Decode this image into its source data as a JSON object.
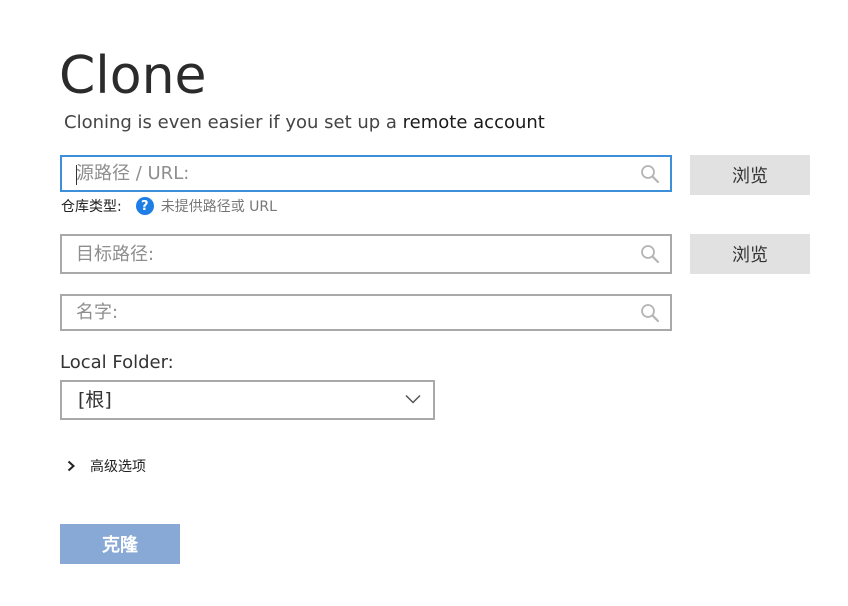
{
  "header": {
    "title": "Clone",
    "subtitle_text": "Cloning is even easier if you set up a ",
    "subtitle_link": "remote account"
  },
  "source": {
    "placeholder": "源路径 / URL:",
    "value": "",
    "browse_label": "浏览",
    "search_icon": "search-icon"
  },
  "repo_type": {
    "label": "仓库类型:",
    "help_glyph": "?",
    "status": "未提供路径或 URL"
  },
  "target": {
    "placeholder": "目标路径:",
    "value": "",
    "browse_label": "浏览"
  },
  "name": {
    "placeholder": "名字:",
    "value": ""
  },
  "local_folder": {
    "label": "Local Folder:",
    "selected": "[根]"
  },
  "advanced": {
    "label": "高级选项"
  },
  "actions": {
    "clone_label": "克隆"
  },
  "colors": {
    "focus_border": "#3c8fd8",
    "help_icon": "#1e7ee6",
    "clone_button": "#88a9d6",
    "browse_button": "#e1e1e1"
  }
}
